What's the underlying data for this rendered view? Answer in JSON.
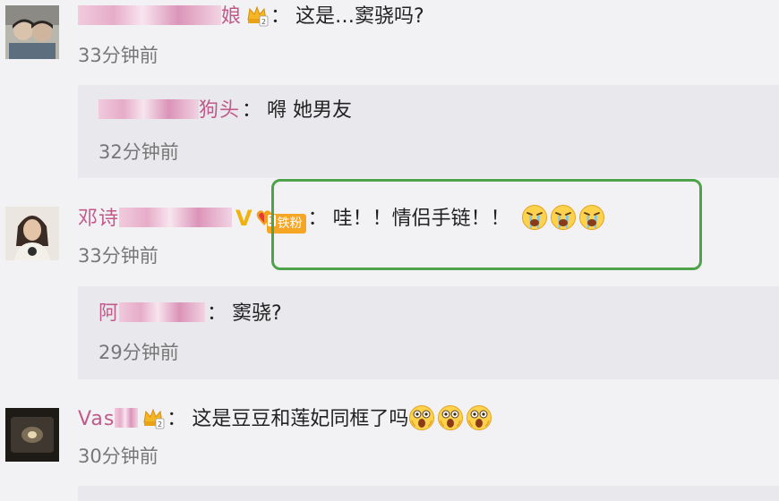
{
  "comments": [
    {
      "id": "c1",
      "name_visible": "娘",
      "separator": "：",
      "text": "这是…窦骁吗?",
      "time": "33分钟前",
      "reply": {
        "name_visible": "狗头",
        "separator": "：",
        "text": "嘚 她男友",
        "time": "32分钟前"
      }
    },
    {
      "id": "c2",
      "name_visible": "邓诗",
      "badge_v": "V",
      "fan_badge_level": "1",
      "fan_badge_label": "铁粉",
      "separator": "：",
      "text": "哇！！情侣手链！！",
      "emojis": [
        "crying-emoji",
        "crying-emoji",
        "crying-emoji"
      ],
      "time": "33分钟前",
      "reply": {
        "name_visible": "阿",
        "separator": "：",
        "text": "窦骁?",
        "time": "29分钟前"
      }
    },
    {
      "id": "c3",
      "name_visible": "Vas",
      "separator": "：",
      "text": "这是豆豆和莲妃同框了吗",
      "emojis": [
        "shocked-emoji",
        "shocked-emoji",
        "shocked-emoji"
      ],
      "time": "30分钟前"
    }
  ],
  "colors": {
    "background": "#f2f2f5",
    "reply_background": "#e9e9ed",
    "username": "#c15a8a",
    "highlight_border": "#4ea24a",
    "fan_badge": "#f6a623",
    "time": "#777777"
  }
}
